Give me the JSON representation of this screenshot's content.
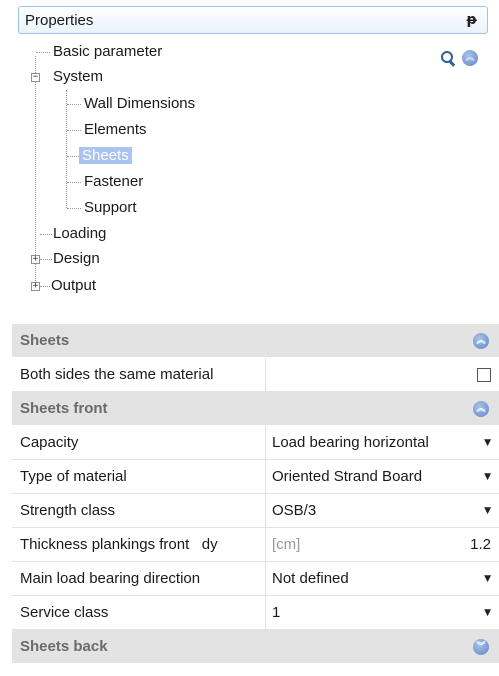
{
  "panel": {
    "title": "Properties",
    "pin_glyph": "ᵽ"
  },
  "tree": {
    "basic_parameter": "Basic parameter",
    "system": "System",
    "wall_dimensions": "Wall Dimensions",
    "elements": "Elements",
    "sheets": "Sheets",
    "fastener": "Fastener",
    "support": "Support",
    "loading": "Loading",
    "design": "Design",
    "output": "Output",
    "expanded_glyph": "−",
    "collapsed_glyph": "+"
  },
  "toolbar": {
    "search_icon": "search-icon",
    "collapse_icon": "collapse-icon",
    "collapse_glyph": "︽"
  },
  "grid": {
    "sheets_category": "Sheets",
    "both_sides_label": "Both sides the same material",
    "both_sides_checked": false,
    "sheets_front_category": "Sheets front",
    "capacity_label": "Capacity",
    "capacity_value": "Load bearing horizontal",
    "material_label": "Type of material",
    "material_value": "Oriented Strand Board",
    "strength_label": "Strength class",
    "strength_value": "OSB/3",
    "thickness_label": "Thickness plankings front   dy",
    "thickness_unit": "[cm]",
    "thickness_value": "1.2",
    "load_dir_label": "Main load bearing direction",
    "load_dir_value": "Not defined",
    "service_label": "Service class",
    "service_value": "1",
    "sheets_back_category": "Sheets back",
    "collapse_up_glyph": "︽",
    "expand_down_glyph": "︾",
    "dropdown_glyph": "▼"
  },
  "colors": {
    "category_bg": "#e3e3e3",
    "selection_bg": "#a9c4ee",
    "title_border": "#9ec3e6"
  }
}
